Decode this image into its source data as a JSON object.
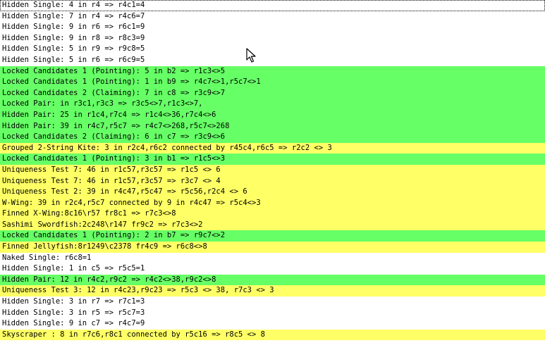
{
  "colors": {
    "white_row": "#ffffff",
    "green_row": "#66ff66",
    "yellow_row": "#ffff66"
  },
  "cursor_icon": "arrow-pointer-icon",
  "log": [
    {
      "text": "Hidden Single: 4 in r4 => r4c1=4",
      "color": "white",
      "selected": true
    },
    {
      "text": "Hidden Single: 7 in r4 => r4c6=7",
      "color": "white"
    },
    {
      "text": "Hidden Single: 9 in r6 => r6c1=9",
      "color": "white"
    },
    {
      "text": "Hidden Single: 9 in r8 => r8c3=9",
      "color": "white"
    },
    {
      "text": "Hidden Single: 5 in r9 => r9c8=5",
      "color": "white"
    },
    {
      "text": "Hidden Single: 5 in r6 => r6c9=5",
      "color": "white"
    },
    {
      "text": "Locked Candidates 1 (Pointing): 5 in b2 => r1c3<>5",
      "color": "green"
    },
    {
      "text": "Locked Candidates 1 (Pointing): 1 in b9 => r4c7<>1,r5c7<>1",
      "color": "green"
    },
    {
      "text": "Locked Candidates 2 (Claiming): 7 in c8 => r3c9<>7",
      "color": "green"
    },
    {
      "text": "Locked Pair: in r3c1,r3c3 => r3c5<>7,r1c3<>7,",
      "color": "green"
    },
    {
      "text": "Hidden Pair: 25 in r1c4,r7c4 => r1c4<>36,r7c4<>6",
      "color": "green"
    },
    {
      "text": "Hidden Pair: 39 in r4c7,r5c7 => r4c7<>268,r5c7<>268",
      "color": "green"
    },
    {
      "text": "Locked Candidates 2 (Claiming): 6 in c7 => r3c9<>6",
      "color": "green"
    },
    {
      "text": "Grouped 2-String Kite: 3 in r2c4,r6c2 connected by r45c4,r6c5 => r2c2 <> 3",
      "color": "yellow"
    },
    {
      "text": "Locked Candidates 1 (Pointing): 3 in b1 => r1c5<>3",
      "color": "green"
    },
    {
      "text": "Uniqueness Test 7: 46 in r1c57,r3c57 => r1c5 <> 6",
      "color": "yellow"
    },
    {
      "text": "Uniqueness Test 7: 46 in r1c57,r3c57 => r3c7 <> 4",
      "color": "yellow"
    },
    {
      "text": "Uniqueness Test 2: 39 in r4c47,r5c47 => r5c56,r2c4 <> 6",
      "color": "yellow"
    },
    {
      "text": "W-Wing: 39 in r2c4,r5c7 connected by 9 in r4c47 => r5c4<>3",
      "color": "yellow"
    },
    {
      "text": "Finned X-Wing:8c16\\r57 fr8c1 => r7c3<>8",
      "color": "yellow"
    },
    {
      "text": "Sashimi Swordfish:2c248\\r147 fr9c2 => r7c3<>2",
      "color": "yellow"
    },
    {
      "text": "Locked Candidates 1 (Pointing): 2 in b7 => r9c7<>2",
      "color": "green"
    },
    {
      "text": "Finned Jellyfish:8r1249\\c2378 fr4c9 => r6c8<>8",
      "color": "yellow"
    },
    {
      "text": "Naked Single: r6c8=1",
      "color": "white"
    },
    {
      "text": "Hidden Single: 1 in c5 => r5c5=1",
      "color": "white"
    },
    {
      "text": "Hidden Pair: 12 in r4c2,r9c2 => r4c2<>38,r9c2<>8",
      "color": "green"
    },
    {
      "text": "Uniqueness Test 3: 12 in r4c23,r9c23 => r5c3 <> 38, r7c3 <> 3",
      "color": "yellow"
    },
    {
      "text": "Hidden Single: 3 in r7 => r7c1=3",
      "color": "white"
    },
    {
      "text": "Hidden Single: 3 in r5 => r5c7=3",
      "color": "white"
    },
    {
      "text": "Hidden Single: 9 in c7 => r4c7=9",
      "color": "white"
    },
    {
      "text": "Skyscraper : 8 in r7c6,r8c1 connected by r5c16 => r8c5 <> 8",
      "color": "yellow"
    }
  ]
}
